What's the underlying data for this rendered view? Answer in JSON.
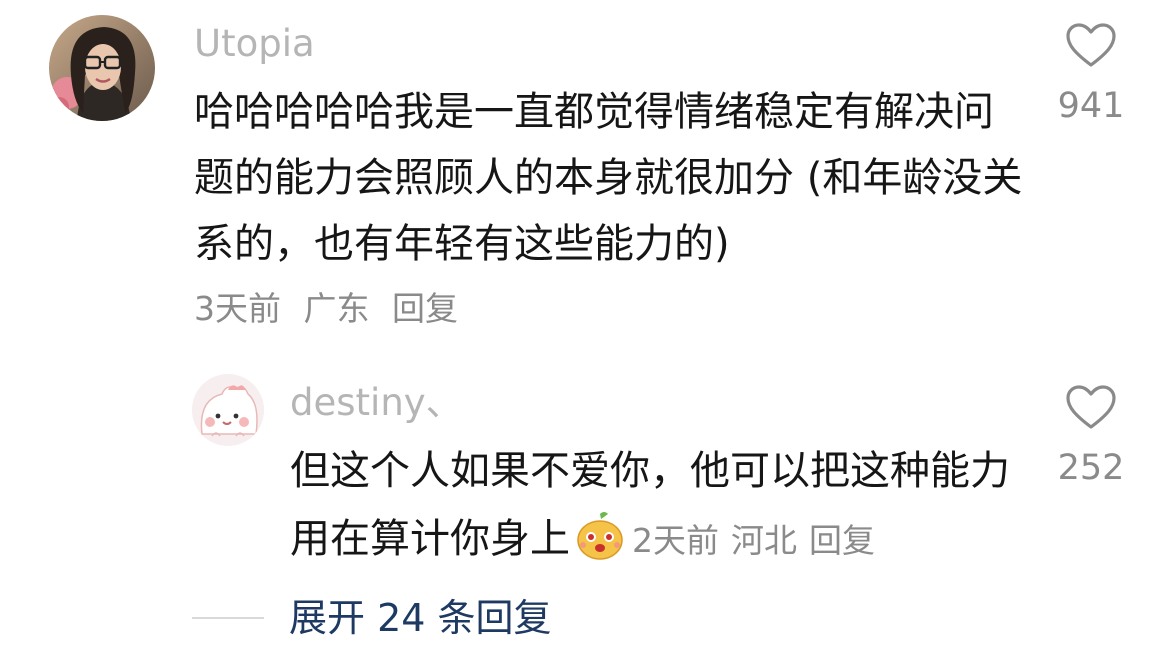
{
  "comment": {
    "username": "Utopia",
    "text": "哈哈哈哈哈我是一直都觉得情绪稳定有解决问题的能力会照顾人的本身就很加分 (和年龄没关系的，也有年轻有这些能力的)",
    "time": "3天前",
    "location": "广东",
    "reply_label": "回复",
    "like_icon": "heart-outline-icon",
    "like_count": "941"
  },
  "reply": {
    "username": "destiny、",
    "text": "但这个人如果不爱你，他可以把这种能力用在算计你身上",
    "emoji": "cute-face-emoji",
    "time": "2天前",
    "location": "河北",
    "reply_label": "回复",
    "like_icon": "heart-outline-icon",
    "like_count": "252"
  },
  "expand": {
    "label": "展开 24 条回复"
  },
  "colors": {
    "text": "#161616",
    "muted": "#8a8a8a",
    "username": "#b5b5b5",
    "link": "#1e3a63"
  }
}
